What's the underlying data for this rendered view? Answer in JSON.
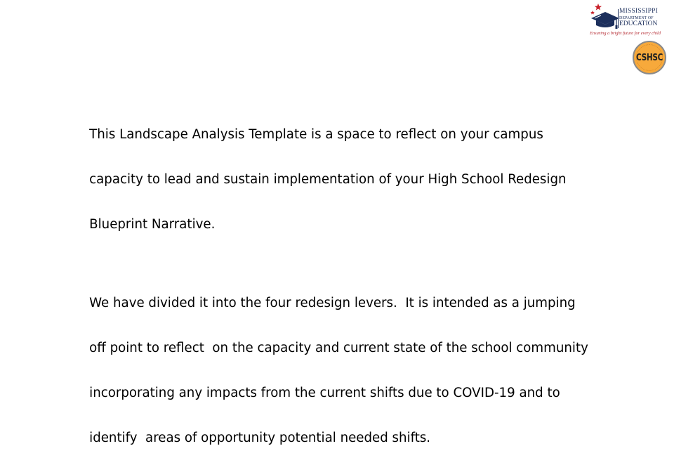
{
  "logos": {
    "mde": {
      "icon": "graduation-cap-icon",
      "line1": "MISSISSIPPI",
      "line2": "DEPARTMENT OF",
      "line3": "EDUCATION",
      "tagline": "Ensuring a bright future for every child",
      "colors": {
        "navy": "#1c2f5c",
        "red": "#b3262e"
      }
    },
    "cshsc": {
      "label": "CSHSC",
      "colors": {
        "fill": "#f7a93b",
        "ring": "#8a8a8a",
        "text": "#222222"
      }
    }
  },
  "body": {
    "paragraphs": [
      "This Landscape Analysis Template is a space to reflect on your campus capacity to lead and sustain implementation of your High School Redesign Blueprint Narrative.",
      "We have divided it into the four redesign levers.  It is intended as a jumping off point to reflect  on the capacity and current state of the school community incorporating any impacts from the current shifts due to COVID-19 and to identify  areas of opportunity potential needed shifts."
    ],
    "lines": [
      [
        "This Landscape Analysis Template is a space to reflect on your campus",
        "capacity to lead and sustain implementation of your High School Redesign",
        "Blueprint Narrative."
      ],
      [
        "We have divided it into the four redesign levers.  It is intended as a jumping",
        "off point to reflect  on the capacity and current state of the school community",
        "incorporating any impacts from the current shifts due to COVID-19 and to",
        "identify  areas of opportunity potential needed shifts."
      ]
    ]
  }
}
